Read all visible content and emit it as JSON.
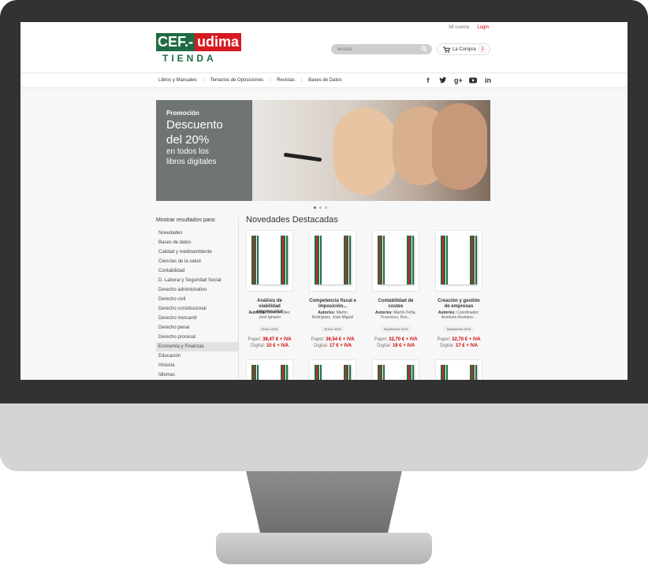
{
  "header": {
    "my_account": "Mi cuenta",
    "login": "Login",
    "logo_cef": "CEF.-",
    "logo_udima": "udima",
    "logo_tienda": "TIENDA",
    "search_placeholder": "Buscar",
    "cart_label": "La Compra",
    "cart_count": "1"
  },
  "nav": {
    "items": [
      "Libros y Manuales",
      "Temarios de Oposiciones",
      "Revistas",
      "Bases de Datos"
    ],
    "social_icons": [
      "facebook-icon",
      "twitter-icon",
      "google-plus-icon",
      "youtube-icon",
      "linkedin-icon"
    ]
  },
  "banner": {
    "label": "Promoción",
    "headline_1": "Descuento",
    "headline_2": "del 20%",
    "sub_1": "en todos los",
    "sub_2": "libros digitales"
  },
  "sidebar": {
    "heading": "Mostrar resultados para:",
    "categories": [
      "Novedades",
      "Bases de datos",
      "Calidad y medioambiente",
      "Ciencias de la salud",
      "Contabilidad",
      "D. Laboral y Seguridad Social",
      "Derecho administrativo",
      "Derecho civil",
      "Derecho constitucional",
      "Derecho mercantil",
      "Derecho penal",
      "Derecho procesal",
      "Economía y Finanzas",
      "Educación",
      "Historia",
      "Idiomas"
    ],
    "selected": "Economía y Finanzas"
  },
  "main": {
    "title": "Novedades Destacadas",
    "paper_label": "Papel:",
    "digital_label": "Digital:",
    "author_label": "Autor/es:",
    "products": [
      {
        "title": "Análisis de viabilidad empresarial",
        "author": "Lorente Olier, José Ignacio",
        "date": "Enero 2015",
        "paper": "38,47 € + IVA",
        "digital": "10 € + IVA"
      },
      {
        "title": "Competencia fiscal e imposición...",
        "author": "Martín Rodríguez, José Miguel",
        "date": "Enero 2015",
        "paper": "36,54 € + IVA",
        "digital": "17 € + IVA"
      },
      {
        "title": "Contabilidad de costes",
        "author": "Martín Peña, Francisco, Ros...",
        "date": "Septiembre 2015",
        "paper": "32,70 € + IVA",
        "digital": "19 € + IVA"
      },
      {
        "title": "Creación y gestión de empresas",
        "author": "Coordinador: Aceituno Aceituno...",
        "date": "Septiembre 2015",
        "paper": "32,70 € + IVA",
        "digital": "17 € + IVA"
      }
    ]
  },
  "colors": {
    "brand_green": "#1f6b44",
    "brand_red": "#d71920",
    "price_red": "#d10000"
  }
}
